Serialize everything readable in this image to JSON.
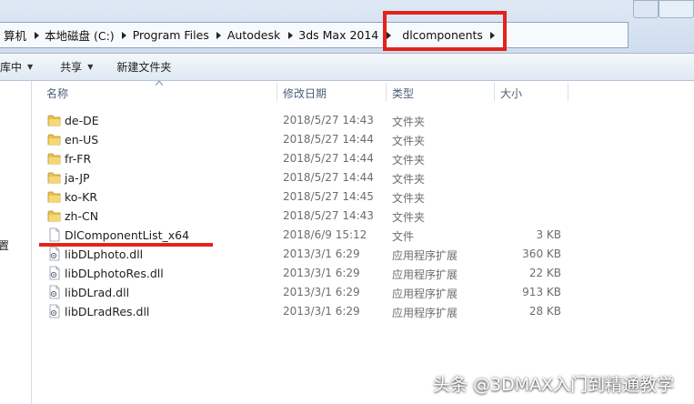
{
  "address": {
    "crumbs": [
      "算机",
      "本地磁盘 (C:)",
      "Program Files",
      "Autodesk",
      "3ds Max 2014",
      "dlcomponents"
    ]
  },
  "toolbar": {
    "organize_label": "库中",
    "share_label": "共享",
    "new_folder_label": "新建文件夹"
  },
  "nav": {
    "partial_label": "置"
  },
  "columns": {
    "name": "名称",
    "date": "修改日期",
    "type": "类型",
    "size": "大小"
  },
  "files": [
    {
      "name": "de-DE",
      "date": "2018/5/27 14:43",
      "type": "文件夹",
      "size": "",
      "icon": "folder-icon"
    },
    {
      "name": "en-US",
      "date": "2018/5/27 14:44",
      "type": "文件夹",
      "size": "",
      "icon": "folder-icon"
    },
    {
      "name": "fr-FR",
      "date": "2018/5/27 14:44",
      "type": "文件夹",
      "size": "",
      "icon": "folder-icon"
    },
    {
      "name": "ja-JP",
      "date": "2018/5/27 14:44",
      "type": "文件夹",
      "size": "",
      "icon": "folder-icon"
    },
    {
      "name": "ko-KR",
      "date": "2018/5/27 14:45",
      "type": "文件夹",
      "size": "",
      "icon": "folder-icon"
    },
    {
      "name": "zh-CN",
      "date": "2018/5/27 14:43",
      "type": "文件夹",
      "size": "",
      "icon": "folder-icon"
    },
    {
      "name": "DlComponentList_x64",
      "date": "2018/6/9 15:12",
      "type": "文件",
      "size": "3 KB",
      "icon": "file-icon"
    },
    {
      "name": "libDLphoto.dll",
      "date": "2013/3/1 6:29",
      "type": "应用程序扩展",
      "size": "360 KB",
      "icon": "dll-icon"
    },
    {
      "name": "libDLphotoRes.dll",
      "date": "2013/3/1 6:29",
      "type": "应用程序扩展",
      "size": "22 KB",
      "icon": "dll-icon"
    },
    {
      "name": "libDLrad.dll",
      "date": "2013/3/1 6:29",
      "type": "应用程序扩展",
      "size": "913 KB",
      "icon": "dll-icon"
    },
    {
      "name": "libDLradRes.dll",
      "date": "2013/3/1 6:29",
      "type": "应用程序扩展",
      "size": "28 KB",
      "icon": "dll-icon"
    }
  ],
  "watermark": "头条 @3DMAX入门到精通教学",
  "colors": {
    "highlight": "#e3231c",
    "folder": "#e8c24f",
    "header_text": "#4c607a"
  }
}
